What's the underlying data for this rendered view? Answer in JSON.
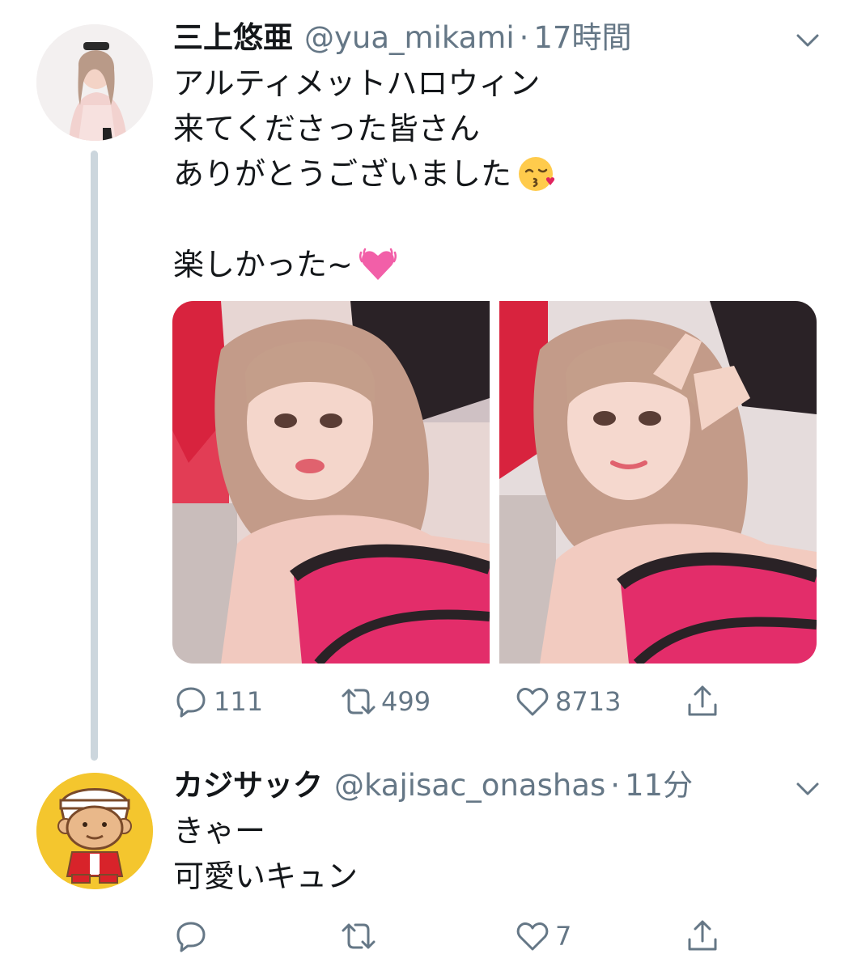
{
  "tweets": [
    {
      "display_name": "三上悠亜",
      "handle": "@yua_mikami",
      "separator": "·",
      "time": "17時間",
      "lines": [
        "アルティメットハロウィン",
        "来てくださった皆さん",
        "ありがとうございました",
        "",
        "楽しかった~"
      ],
      "line_emoji": [
        "",
        "",
        "kissing-face-emoji",
        "",
        "beating-heart-emoji"
      ],
      "actions": {
        "reply": "111",
        "retweet": "499",
        "like": "8713"
      }
    },
    {
      "display_name": "カジサック",
      "handle": "@kajisac_onashas",
      "separator": "·",
      "time": "11分",
      "lines": [
        "きゃー",
        "可愛いキュン"
      ],
      "actions": {
        "reply": "",
        "retweet": "",
        "like": "7"
      }
    }
  ],
  "colors": {
    "text": "#14171a",
    "secondary": "#657786",
    "thread_line": "#ccd6dd",
    "avatar2_bg": "#f4c62e"
  }
}
